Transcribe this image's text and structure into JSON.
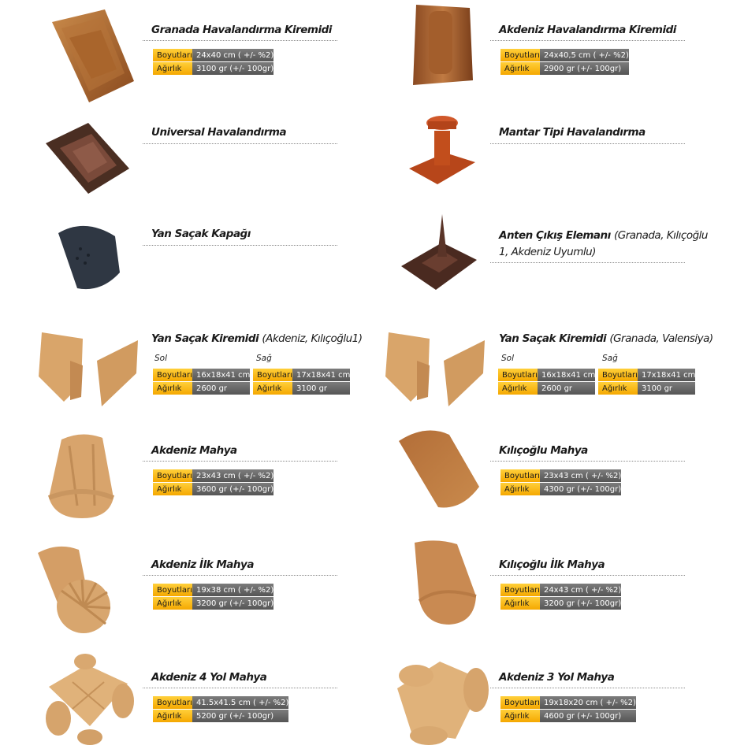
{
  "labels": {
    "size": "Boyutları",
    "weight": "Ağırlık",
    "left": "Sol",
    "right": "Sağ"
  },
  "colors": {
    "key_bg": "#f5a800",
    "value_bg": "#5e5e5e",
    "rule": "#8a8a8a"
  },
  "products": {
    "granada_vent": {
      "name": "Granada Havalandırma Kiremidi",
      "size": "24x40 cm ( +/- %2)",
      "weight": "3100 gr (+/- 100gr)"
    },
    "akdeniz_vent": {
      "name": "Akdeniz Havalandırma Kiremidi",
      "size": "24x40,5 cm ( +/- %2)",
      "weight": "2900 gr (+/- 100gr)"
    },
    "universal": {
      "name": "Universal Havalandırma"
    },
    "mantar": {
      "name": "Mantar Tipi Havalandırma"
    },
    "yan_kapak": {
      "name": "Yan Saçak Kapağı"
    },
    "anten": {
      "name": "Anten Çıkış Elemanı",
      "note": "(Granada, Kılıçoğlu 1, Akdeniz Uyumlu)"
    },
    "yan_akdeniz": {
      "name": "Yan Saçak Kiremidi",
      "note": "(Akdeniz, Kılıçoğlu1)",
      "left": {
        "size": "16x18x41 cm",
        "weight": "2600 gr"
      },
      "right": {
        "size": "17x18x41 cm",
        "weight": "3100 gr"
      }
    },
    "yan_granada": {
      "name": "Yan Saçak Kiremidi",
      "note": "(Granada, Valensiya)",
      "left": {
        "size": "16x18x41 cm",
        "weight": "2600 gr"
      },
      "right": {
        "size": "17x18x41 cm",
        "weight": "3100 gr"
      }
    },
    "akdeniz_mahya": {
      "name": "Akdeniz Mahya",
      "size": "23x43 cm ( +/- %2)",
      "weight": "3600 gr (+/- 100gr)"
    },
    "kilicoglu_mahya": {
      "name": "Kılıçoğlu Mahya",
      "size": "23x43 cm ( +/- %2)",
      "weight": "4300 gr (+/- 100gr)"
    },
    "akdeniz_ilk": {
      "name": "Akdeniz İlk Mahya",
      "size": "19x38 cm ( +/- %2)",
      "weight": "3200 gr (+/- 100gr)"
    },
    "kilicoglu_ilk": {
      "name": "Kılıçoğlu İlk Mahya",
      "size": "24x43 cm ( +/- %2)",
      "weight": "3200 gr (+/- 100gr)"
    },
    "akdeniz_4yol": {
      "name": "Akdeniz 4 Yol Mahya",
      "size": "41.5x41.5 cm ( +/- %2)",
      "weight": "5200 gr (+/- 100gr)"
    },
    "akdeniz_3yol": {
      "name": "Akdeniz 3 Yol Mahya",
      "size": "19x18x20 cm ( +/- %2)",
      "weight": "4600 gr (+/- 100gr)"
    }
  }
}
